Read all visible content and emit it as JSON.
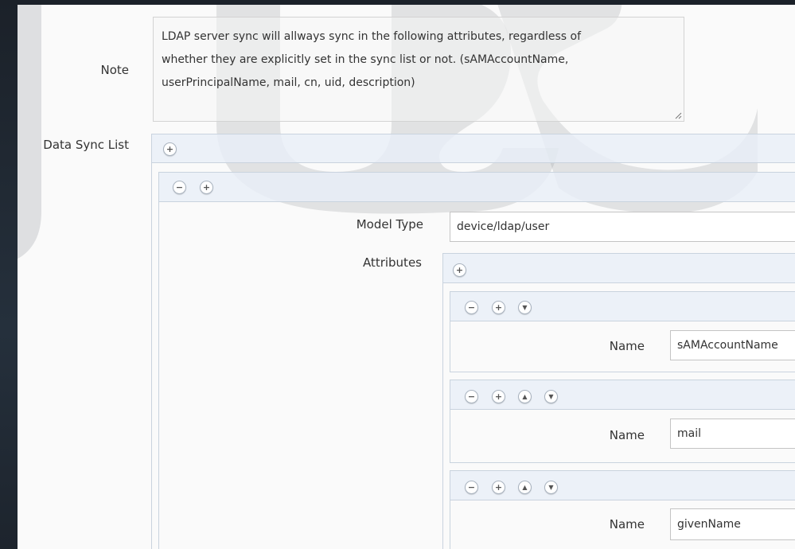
{
  "note": {
    "label": "Note",
    "text_lines": [
      "LDAP server sync will allways sync in the following attributes, regardless of",
      "whether they are explicitly set in the sync list or not. (sAMAccountName,",
      "userPrincipalName, mail, cn, uid, description)"
    ]
  },
  "data_sync_list": {
    "label": "Data Sync List",
    "add_icon": "plus-circle-icon",
    "entry": {
      "remove_icon": "minus-circle-icon",
      "add_icon": "plus-circle-icon",
      "model_type_label": "Model Type",
      "model_type_value": "device/ldap/user",
      "attributes_label": "Attributes",
      "attributes_add_icon": "plus-circle-icon",
      "attributes": [
        {
          "name_label": "Name",
          "name_value": "sAMAccountName",
          "controls": [
            "minus",
            "plus",
            "down"
          ]
        },
        {
          "name_label": "Name",
          "name_value": "mail",
          "controls": [
            "minus",
            "plus",
            "up",
            "down"
          ]
        },
        {
          "name_label": "Name",
          "name_value": "givenName",
          "controls": [
            "minus",
            "plus",
            "up",
            "down"
          ]
        }
      ]
    }
  },
  "colors": {
    "panel_bg": "#fafafa",
    "frame_bg": "#1f2732",
    "header_bar": "#e8eff7",
    "watermark": "#c7c9cc"
  }
}
